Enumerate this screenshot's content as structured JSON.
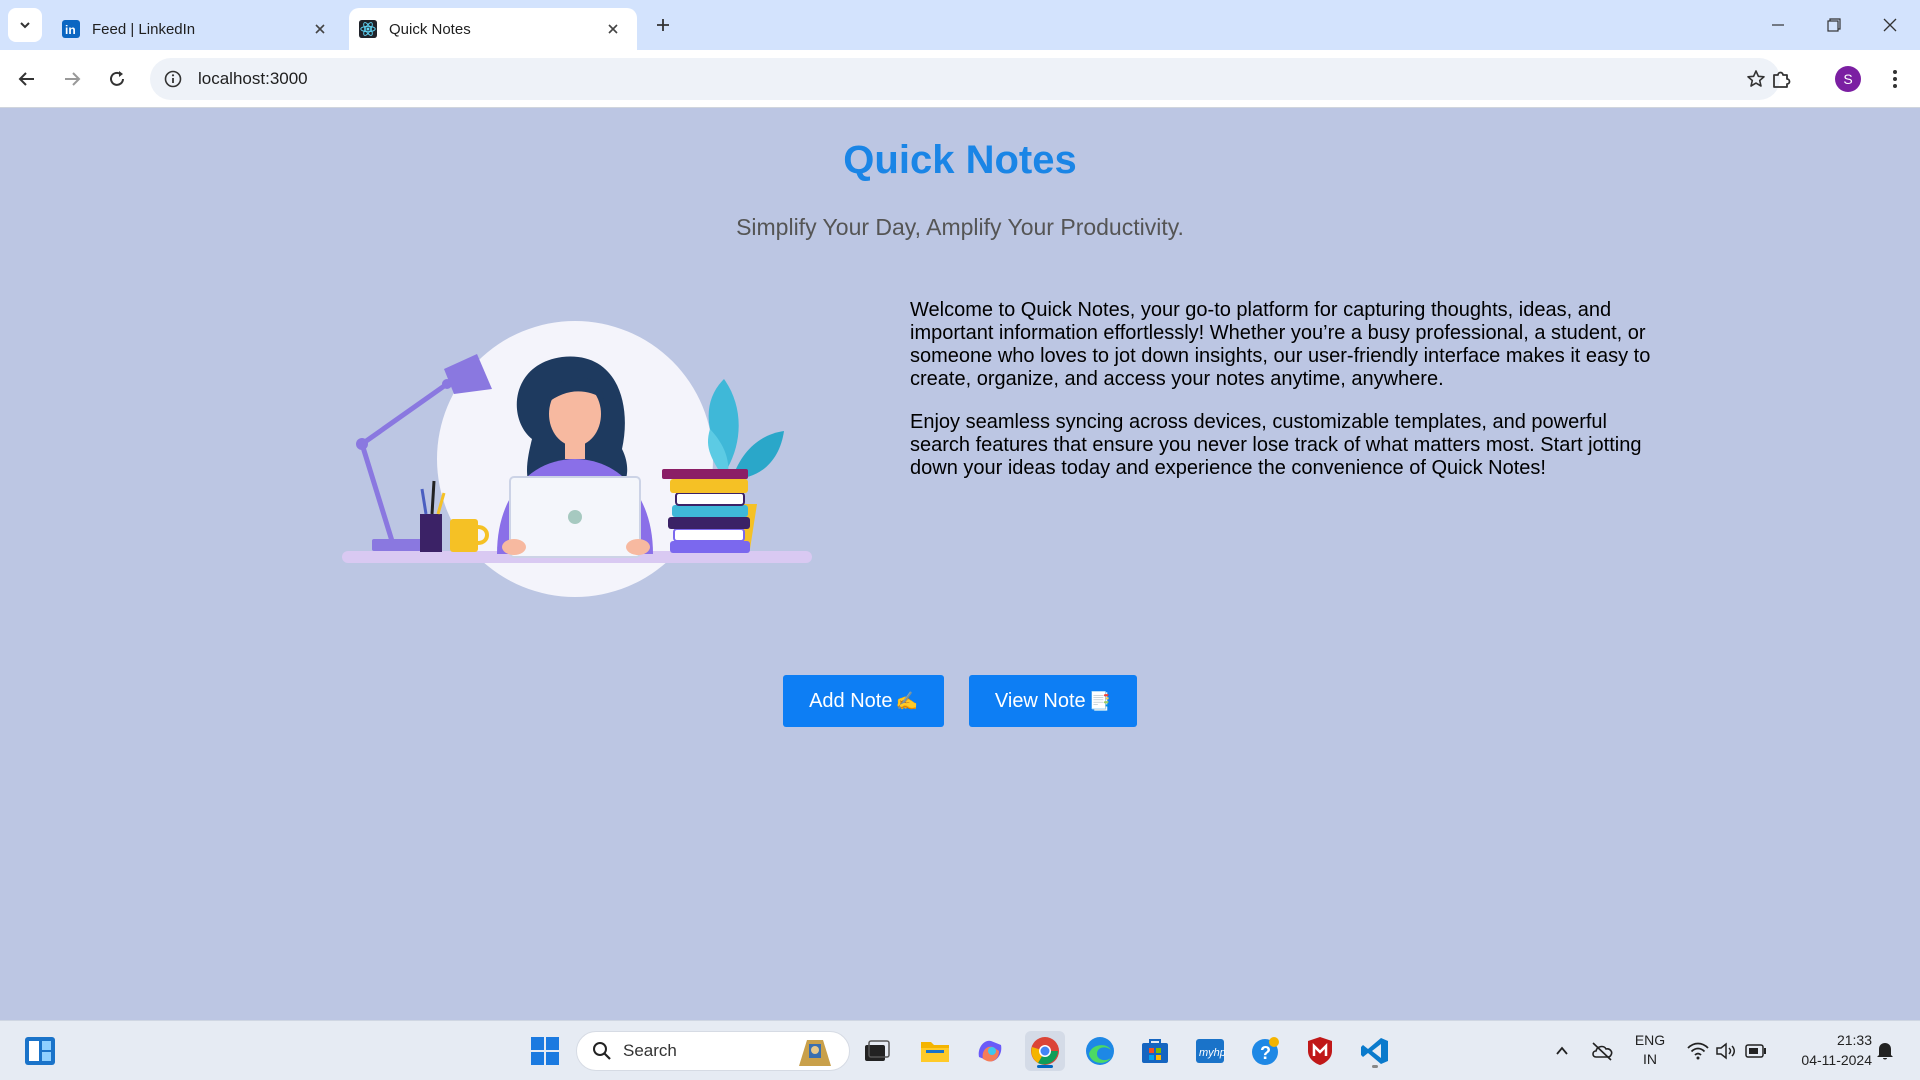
{
  "browser": {
    "tabs": [
      {
        "title": "Feed | LinkedIn",
        "icon": "linkedin-icon"
      },
      {
        "title": "Quick Notes",
        "icon": "react-icon"
      }
    ],
    "url": "localhost:3000",
    "profile_initial": "S"
  },
  "page": {
    "title": "Quick Notes",
    "tagline": "Simplify Your Day, Amplify Your Productivity.",
    "paragraphs": [
      "Welcome to Quick Notes, your go-to platform for capturing thoughts, ideas, and important information effortlessly! Whether you’re a busy professional, a student, or someone who loves to jot down insights, our user-friendly interface makes it easy to create, organize, and access your notes anytime, anywhere.",
      "Enjoy seamless syncing across devices, customizable templates, and powerful search features that ensure you never lose track of what matters most. Start jotting down your ideas today and experience the convenience of Quick Notes!"
    ],
    "buttons": {
      "add_label": "Add Note",
      "add_emoji": "✍️",
      "view_label": "View Note",
      "view_emoji": "📑"
    },
    "colors": {
      "background": "#bcc6e3",
      "title": "#1a85e6",
      "button": "#0d7ef4"
    }
  },
  "taskbar": {
    "search_placeholder": "Search",
    "language": "ENG",
    "region": "IN",
    "time": "21:33",
    "date": "04-11-2024"
  }
}
